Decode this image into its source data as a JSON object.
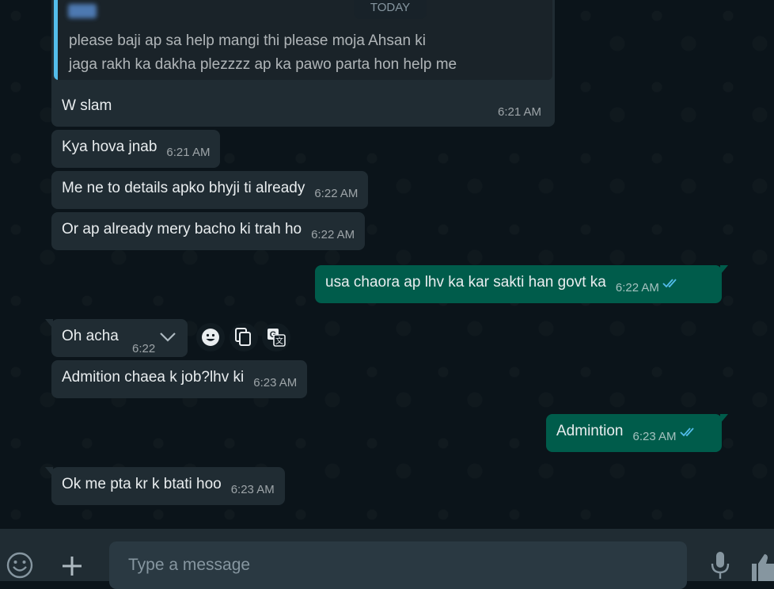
{
  "date_chip": "TODAY",
  "quoted": {
    "text_line1": "please baji ap sa help mangi thi please moja Ahsan ki",
    "text_line2": "jaga rakh ka dakha plezzzz ap ka pawo parta hon help me"
  },
  "messages": [
    {
      "text": "W slam",
      "time": "6:21 AM",
      "direction": "in"
    },
    {
      "text": "Kya hova jnab",
      "time": "6:21 AM",
      "direction": "in"
    },
    {
      "text": "Me ne to details apko bhyji ti already",
      "time": "6:22 AM",
      "direction": "in"
    },
    {
      "text": "Or ap already mery bacho ki trah ho",
      "time": "6:22 AM",
      "direction": "in"
    },
    {
      "text": "usa chaora ap lhv ka kar sakti han govt ka",
      "time": "6:22 AM",
      "direction": "out",
      "status": "read"
    },
    {
      "text": "Oh acha",
      "time": "6:22",
      "direction": "in"
    },
    {
      "text": "Admition chaea k job?lhv ki",
      "time": "6:23 AM",
      "direction": "in"
    },
    {
      "text": "Admintion",
      "time": "6:23 AM",
      "direction": "out",
      "status": "read"
    },
    {
      "text": "Ok me pta kr k btati hoo",
      "time": "6:23 AM",
      "direction": "in"
    }
  ],
  "composer": {
    "placeholder": "Type a message"
  },
  "colors": {
    "incoming": "#202c33",
    "outgoing": "#005c4b",
    "read_ticks": "#53bdeb",
    "background": "#0b141a"
  }
}
